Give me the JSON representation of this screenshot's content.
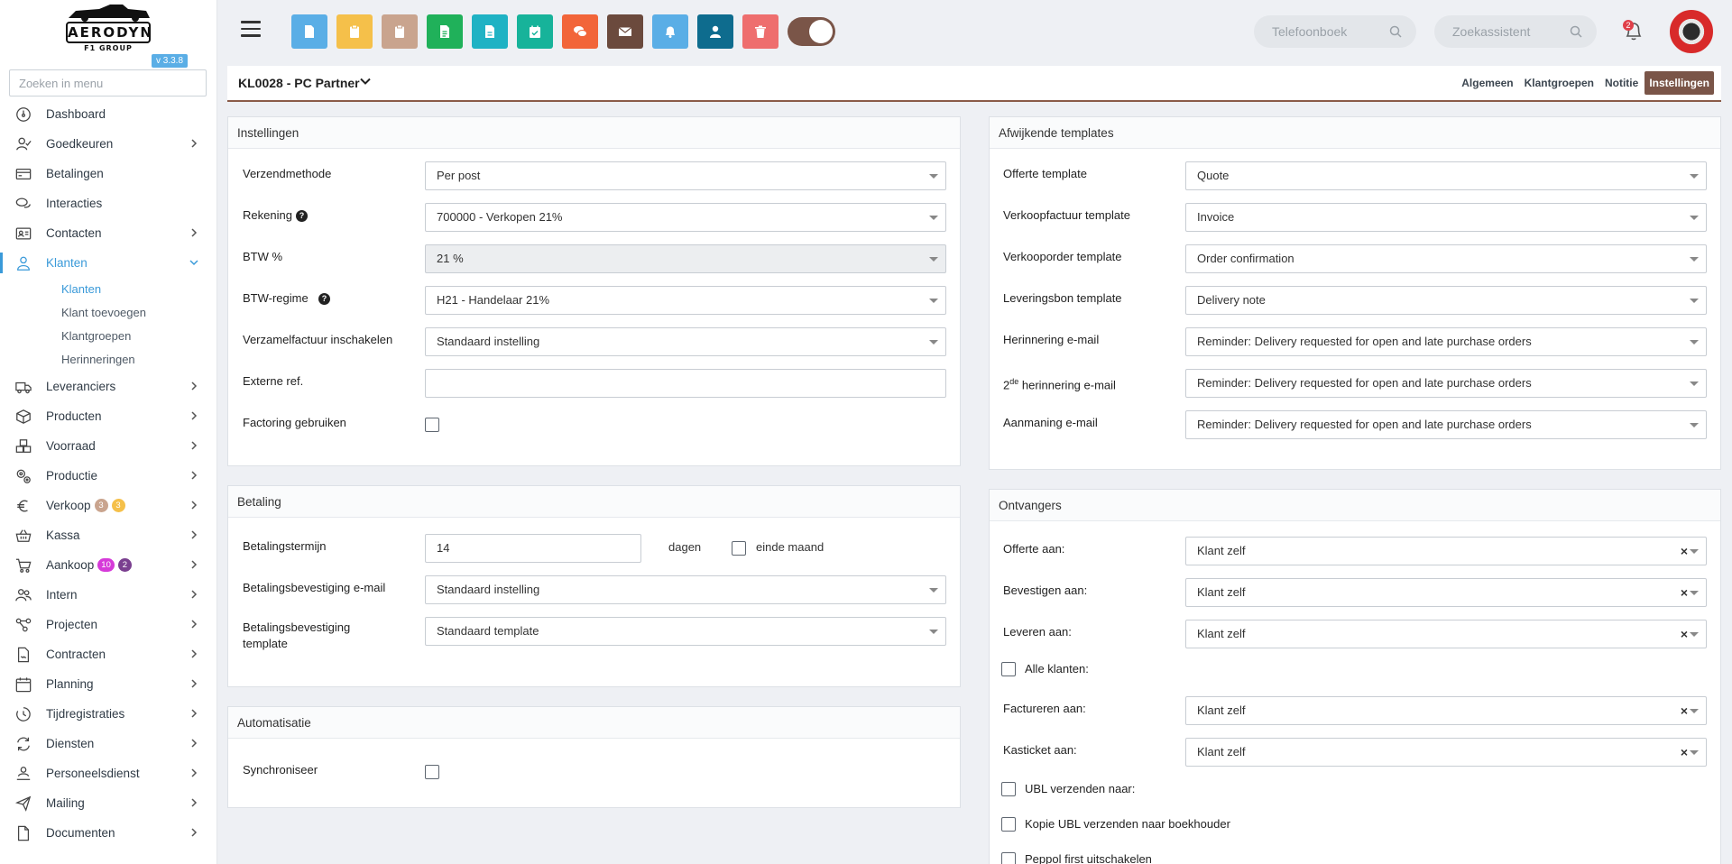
{
  "app": {
    "logo_text": "AERODYN",
    "logo_sub": "F1 GROUP",
    "version": "v 3.3.8"
  },
  "sidebar": {
    "search_placeholder": "Zoeken in menu",
    "items": [
      {
        "label": "Dashboard",
        "icon": "dashboard-icon",
        "chevron": false
      },
      {
        "label": "Goedkeuren",
        "icon": "approve-icon",
        "chevron": true
      },
      {
        "label": "Betalingen",
        "icon": "payments-icon",
        "chevron": false
      },
      {
        "label": "Interacties",
        "icon": "chat-icon",
        "chevron": false
      },
      {
        "label": "Contacten",
        "icon": "contact-card-icon",
        "chevron": true
      },
      {
        "label": "Klanten",
        "icon": "user-icon",
        "chevron": true,
        "active": true
      },
      {
        "label": "Leveranciers",
        "icon": "truck-icon",
        "chevron": true
      },
      {
        "label": "Producten",
        "icon": "box-icon",
        "chevron": true
      },
      {
        "label": "Voorraad",
        "icon": "stock-icon",
        "chevron": true
      },
      {
        "label": "Productie",
        "icon": "gears-icon",
        "chevron": true
      },
      {
        "label": "Verkoop",
        "icon": "euro-icon",
        "chevron": true
      },
      {
        "label": "Kassa",
        "icon": "basket-icon",
        "chevron": true
      },
      {
        "label": "Aankoop",
        "icon": "cart-icon",
        "chevron": true
      },
      {
        "label": "Intern",
        "icon": "team-icon",
        "chevron": true
      },
      {
        "label": "Projecten",
        "icon": "project-icon",
        "chevron": true
      },
      {
        "label": "Contracten",
        "icon": "contract-icon",
        "chevron": true
      },
      {
        "label": "Planning",
        "icon": "calendar-icon",
        "chevron": true
      },
      {
        "label": "Tijdregistraties",
        "icon": "clock-icon",
        "chevron": true
      },
      {
        "label": "Diensten",
        "icon": "services-icon",
        "chevron": true
      },
      {
        "label": "Personeelsdienst",
        "icon": "staff-icon",
        "chevron": true
      },
      {
        "label": "Mailing",
        "icon": "send-icon",
        "chevron": true
      },
      {
        "label": "Documenten",
        "icon": "document-icon",
        "chevron": true
      }
    ],
    "klanten_sub": [
      "Klanten",
      "Klant toevoegen",
      "Klantgroepen",
      "Herinneringen"
    ],
    "verkoop_badges": [
      "3",
      "3"
    ],
    "aankoop_badges": [
      "10",
      "2"
    ]
  },
  "topbar": {
    "search_phonebook": "Telefoonboek",
    "search_assistant": "Zoekassistent",
    "notification_count": "2",
    "buttons": [
      {
        "name": "new-quote-button",
        "color": "#5aaee6",
        "icon": "file-icon"
      },
      {
        "name": "new-order-button",
        "color": "#f5c04a",
        "icon": "clipboard-icon"
      },
      {
        "name": "delivery-button",
        "color": "#c9a48e",
        "icon": "clipboard-check-icon"
      },
      {
        "name": "invoice-button",
        "color": "#20b15a",
        "icon": "invoice-icon"
      },
      {
        "name": "credit-note-button",
        "color": "#1fb2c4",
        "icon": "file-text-icon"
      },
      {
        "name": "task-button",
        "color": "#17b39a",
        "icon": "calendar-check-icon"
      },
      {
        "name": "interaction-button",
        "color": "#f26539",
        "icon": "comments-icon"
      },
      {
        "name": "mail-button",
        "color": "#6b4a3d",
        "icon": "envelope-icon"
      },
      {
        "name": "reminder-button",
        "color": "#5aaee6",
        "icon": "bell-icon"
      },
      {
        "name": "user-button",
        "color": "#0e6c8e",
        "icon": "user-icon"
      },
      {
        "name": "delete-button",
        "color": "#ee6e6e",
        "icon": "trash-icon"
      }
    ]
  },
  "header": {
    "title": "KL0028 - PC Partner",
    "tabs": [
      "Algemeen",
      "Klantgroepen",
      "Notitie",
      "Instellingen"
    ]
  },
  "instellingen": {
    "title": "Instellingen",
    "rows": [
      {
        "label": "Verzendmethode",
        "value": "Per post"
      },
      {
        "label": "Rekening",
        "value": "700000 - Verkopen 21%"
      },
      {
        "label": "BTW %",
        "value": "21 %"
      },
      {
        "label": "BTW-regime",
        "value": "H21 - Handelaar 21%"
      },
      {
        "label": "Verzamelfactuur inschakelen",
        "value": "Standaard instelling"
      },
      {
        "label": "Externe ref.",
        "value": ""
      },
      {
        "label": "Factoring gebruiken",
        "value": ""
      }
    ]
  },
  "betaling": {
    "title": "Betaling",
    "termijn_label": "Betalingstermijn",
    "termijn_value": "14",
    "dagen": "dagen",
    "einde_maand": "einde maand",
    "email_label": "Betalingsbevestiging e-mail",
    "email_value": "Standaard instelling",
    "template_label_1": "Betalingsbevestiging",
    "template_label_2": "template",
    "template_value": "Standaard template"
  },
  "automatisatie": {
    "title": "Automatisatie",
    "sync_label": "Synchroniseer"
  },
  "templates": {
    "title": "Afwijkende templates",
    "rows": [
      {
        "label": "Offerte template",
        "value": "Quote"
      },
      {
        "label": "Verkoopfactuur template",
        "value": "Invoice"
      },
      {
        "label": "Verkooporder template",
        "value": "Order confirmation"
      },
      {
        "label": "Leveringsbon template",
        "value": "Delivery note"
      },
      {
        "label": "Herinnering e-mail",
        "value": "Reminder: Delivery requested for open and late purchase orders"
      },
      {
        "label_pre": "2",
        "label_sup": "de",
        "label_post": " herinnering e-mail",
        "value": "Reminder: Delivery requested for open and late purchase orders"
      },
      {
        "label": "Aanmaning e-mail",
        "value": "Reminder: Delivery requested for open and late purchase orders"
      }
    ]
  },
  "ontvangers": {
    "title": "Ontvangers",
    "offerte_label": "Offerte aan:",
    "offerte_value": "Klant zelf",
    "bevestigen_label": "Bevestigen aan:",
    "bevestigen_value": "Klant zelf",
    "leveren_label": "Leveren aan:",
    "leveren_value": "Klant zelf",
    "alle_klanten": "Alle klanten:",
    "factureren_label": "Factureren aan:",
    "factureren_value": "Klant zelf",
    "kasticket_label": "Kasticket aan:",
    "kasticket_value": "Klant zelf",
    "ubl_label": "UBL verzenden naar:",
    "kopie_ubl_label": "Kopie UBL verzenden naar boekhouder",
    "peppol_label": "Peppol first uitschakelen",
    "clear_symbol": "×"
  }
}
